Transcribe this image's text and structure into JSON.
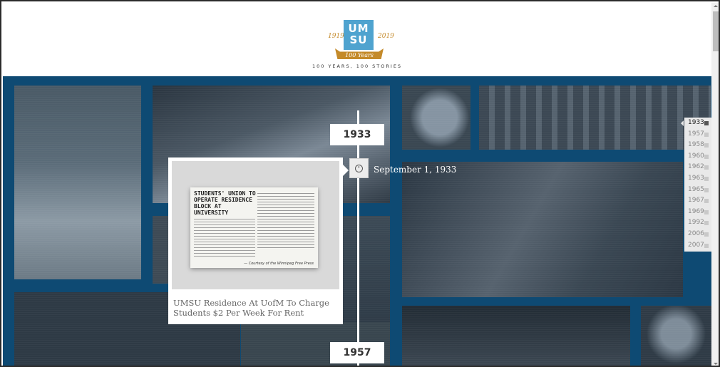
{
  "header": {
    "logo_line1": "UM",
    "logo_line2": "SU",
    "year_start": "1919",
    "year_end": "2019",
    "ribbon": "100 Years",
    "tagline": "100 YEARS, 100 STORIES"
  },
  "timeline": {
    "current_year": "1933",
    "next_year": "1957",
    "date": "September 1, 1933"
  },
  "card": {
    "clipping_headline": "STUDENTS' UNION TO OPERATE RESIDENCE BLOCK AT UNIVERSITY",
    "clipping_credit": "— Courtesy of the Winnipeg Free Press",
    "title": "UMSU Residence At UofM To Charge Students $2 Per Week For Rent"
  },
  "year_nav": {
    "items": [
      "1933",
      "1957",
      "1958",
      "1960",
      "1962",
      "1963",
      "1965",
      "1967",
      "1969",
      "1992",
      "2006",
      "2007"
    ],
    "active": "1933"
  },
  "colors": {
    "wall": "#0e4a73",
    "logo": "#4fa3cf",
    "gold": "#c48a2a"
  }
}
